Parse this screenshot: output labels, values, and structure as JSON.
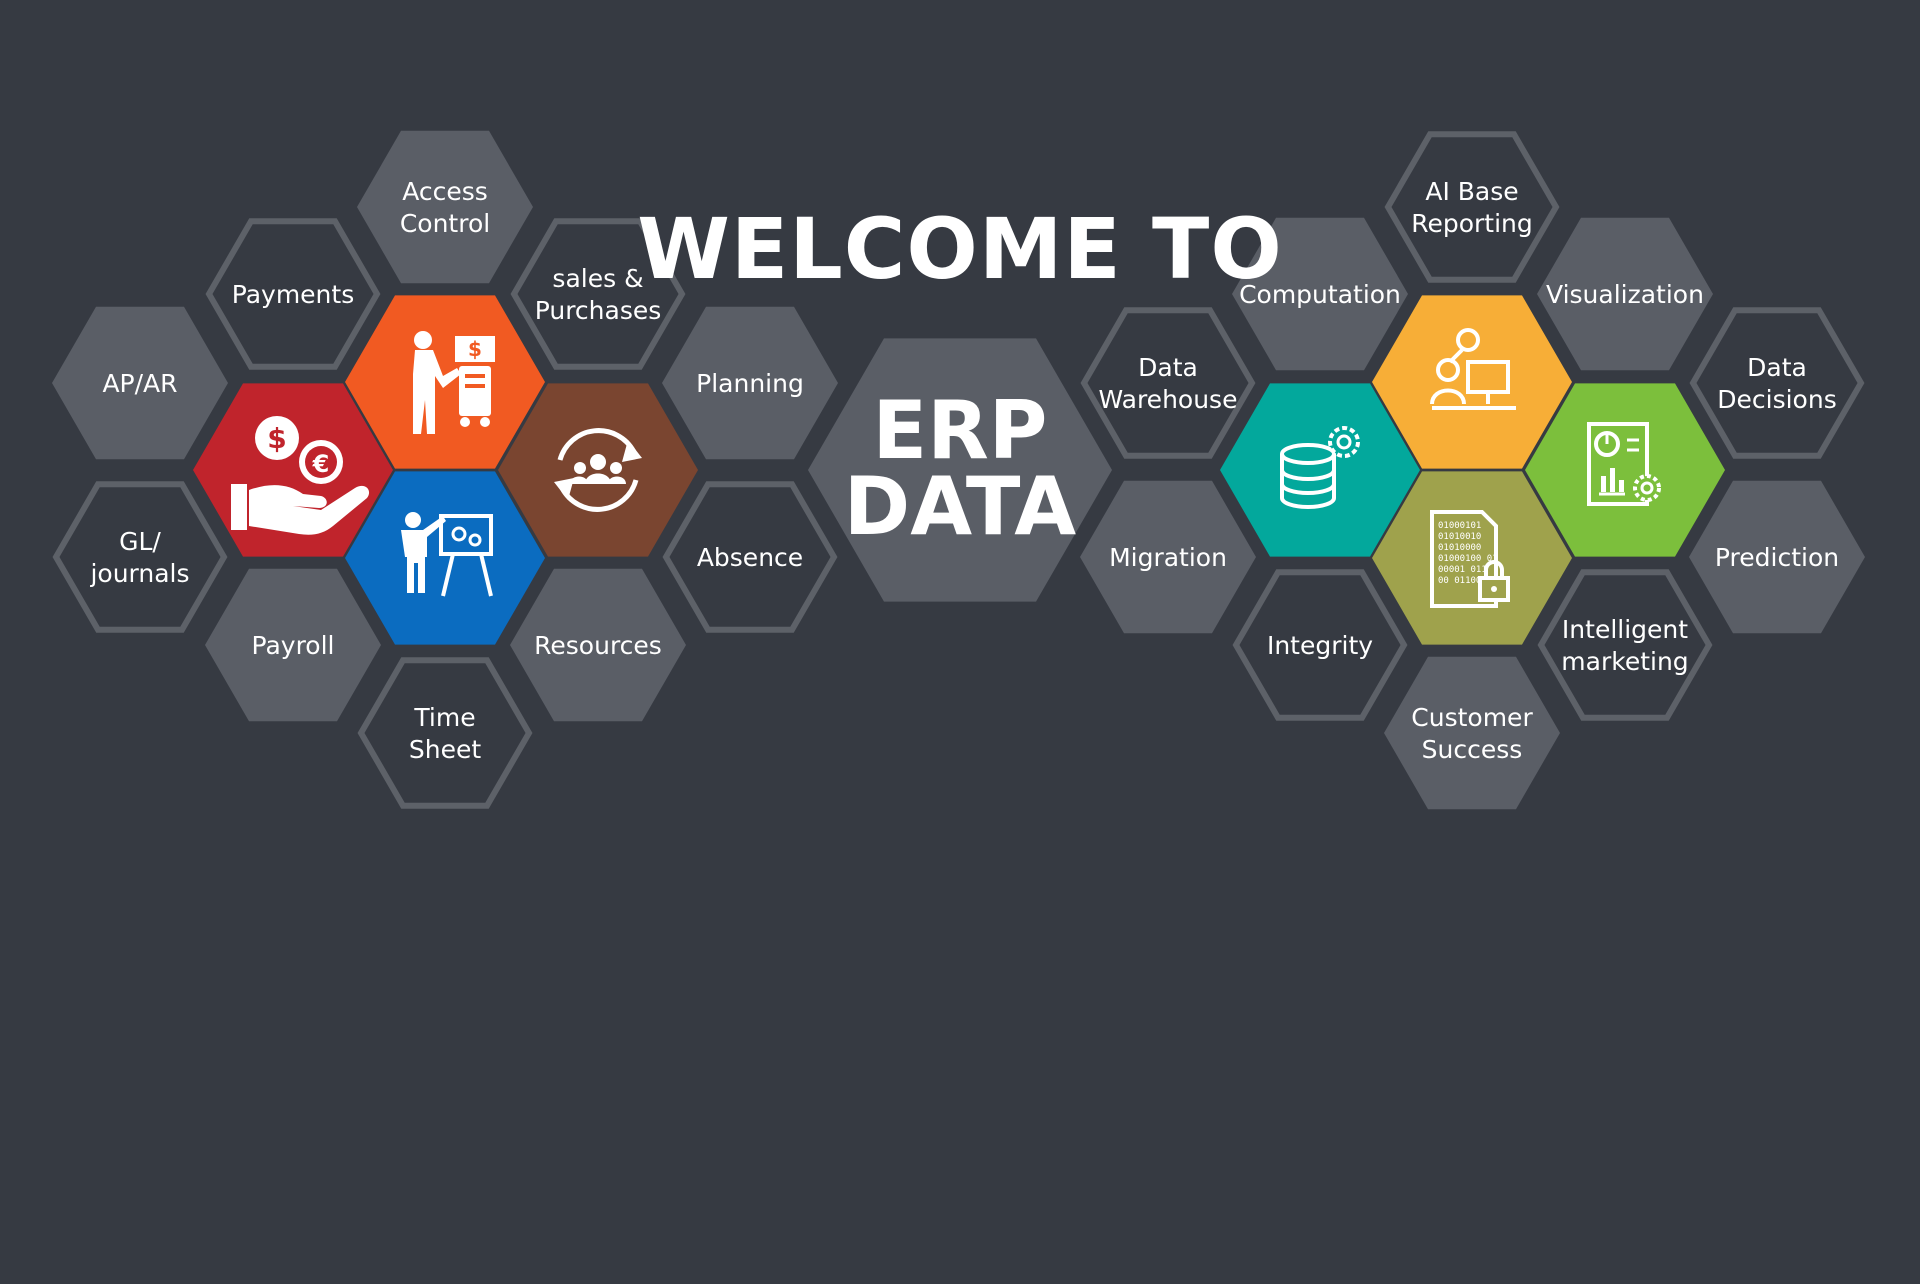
{
  "banner": {
    "title": "WELCOME TO",
    "center_lines": [
      "ERP",
      "DATA"
    ]
  },
  "colors": {
    "background": "#363a42",
    "gray_hex": "#5a5e66",
    "outline_hex": "#5d6168",
    "red": "#c0242c",
    "orange": "#f15a22",
    "blue": "#0b6cc0",
    "brown": "#7a4530",
    "teal": "#03a89c",
    "amber": "#f7ae37",
    "green": "#7cbf3c",
    "olive": "#9fa24c"
  },
  "left_cluster": {
    "tiles": [
      {
        "id": "access-control",
        "lines": [
          "Access",
          "Control"
        ]
      },
      {
        "id": "payments",
        "lines": [
          "Payments"
        ]
      },
      {
        "id": "sales-purchases",
        "lines": [
          "sales &",
          "Purchases"
        ]
      },
      {
        "id": "ap-ar",
        "lines": [
          "AP/AR"
        ]
      },
      {
        "id": "planning",
        "lines": [
          "Planning"
        ]
      },
      {
        "id": "gl-journals",
        "lines": [
          "GL/",
          "journals"
        ]
      },
      {
        "id": "absence",
        "lines": [
          "Absence"
        ]
      },
      {
        "id": "payroll",
        "lines": [
          "Payroll"
        ]
      },
      {
        "id": "resources",
        "lines": [
          "Resources"
        ]
      },
      {
        "id": "time-sheet",
        "lines": [
          "Time",
          "Sheet"
        ]
      }
    ],
    "icon_tiles": [
      {
        "id": "money-hand",
        "icon": "money-in-hand-icon"
      },
      {
        "id": "sales-terminal",
        "icon": "sales-terminal-icon"
      },
      {
        "id": "team-cycle",
        "icon": "team-cycle-icon"
      },
      {
        "id": "presentation",
        "icon": "presentation-icon"
      }
    ]
  },
  "right_cluster": {
    "tiles": [
      {
        "id": "ai-base-reporting",
        "lines": [
          "AI Base",
          "Reporting"
        ]
      },
      {
        "id": "computation",
        "lines": [
          "Computation"
        ]
      },
      {
        "id": "visualization",
        "lines": [
          "Visualization"
        ]
      },
      {
        "id": "data-warehouse",
        "lines": [
          "Data",
          "Warehouse"
        ]
      },
      {
        "id": "data-decisions",
        "lines": [
          "Data",
          "Decisions"
        ]
      },
      {
        "id": "migration",
        "lines": [
          "Migration"
        ]
      },
      {
        "id": "prediction",
        "lines": [
          "Prediction"
        ]
      },
      {
        "id": "integrity",
        "lines": [
          "Integrity"
        ]
      },
      {
        "id": "intelligent-marketing",
        "lines": [
          "Intelligent",
          "marketing"
        ]
      },
      {
        "id": "customer-success",
        "lines": [
          "Customer",
          "Success"
        ]
      }
    ],
    "icon_tiles": [
      {
        "id": "database-gear",
        "icon": "database-gear-icon"
      },
      {
        "id": "support-desk",
        "icon": "support-desk-icon"
      },
      {
        "id": "report-chart",
        "icon": "report-chart-icon"
      },
      {
        "id": "secure-data",
        "icon": "secure-data-file-icon",
        "code_lines": [
          "01000101",
          "01010010",
          "01010000",
          "01000100 01",
          "00001 011",
          "00 011000"
        ]
      }
    ]
  }
}
